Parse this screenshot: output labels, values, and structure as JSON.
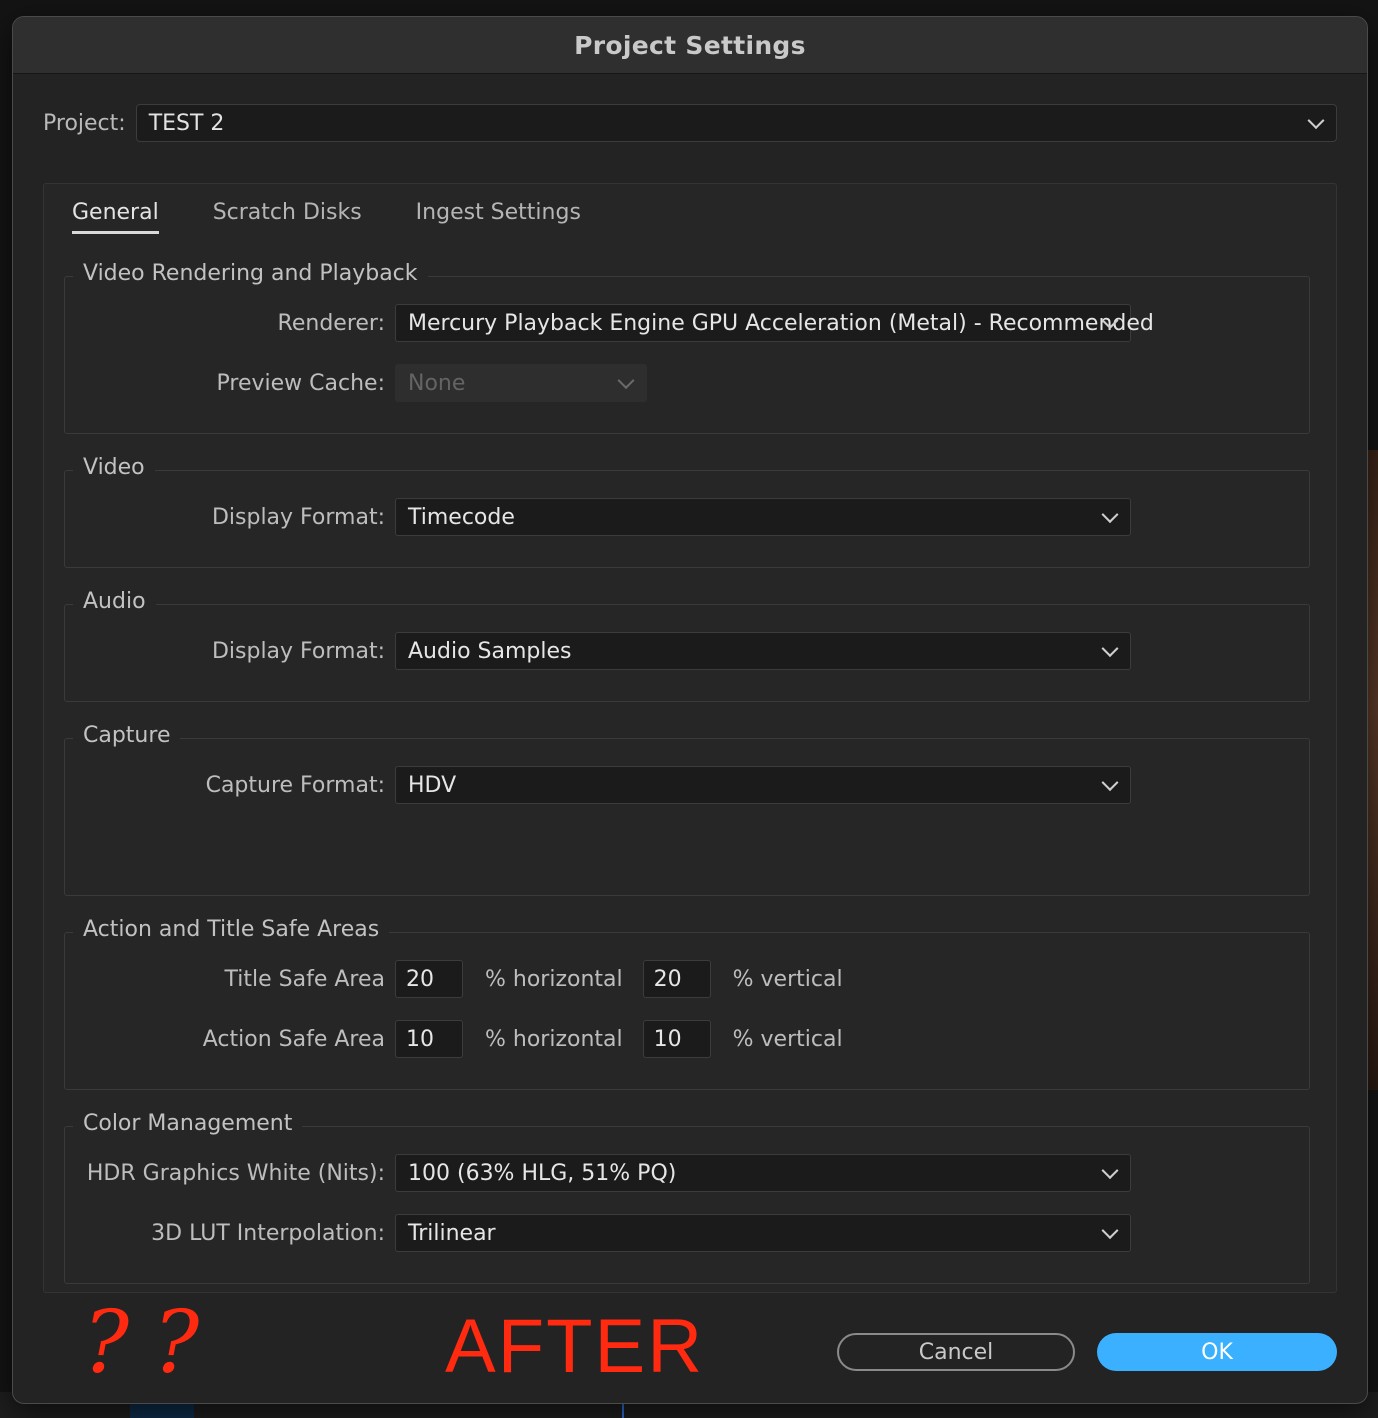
{
  "window": {
    "title": "Project Settings"
  },
  "project": {
    "label": "Project:",
    "value": "TEST 2"
  },
  "tabs": [
    {
      "label": "General",
      "active": true
    },
    {
      "label": "Scratch Disks",
      "active": false
    },
    {
      "label": "Ingest Settings",
      "active": false
    }
  ],
  "sections": {
    "video_rendering": {
      "title": "Video Rendering and Playback",
      "renderer_label": "Renderer:",
      "renderer_value": "Mercury Playback Engine GPU Acceleration (Metal) - Recommended",
      "preview_cache_label": "Preview Cache:",
      "preview_cache_value": "None"
    },
    "video": {
      "title": "Video",
      "display_format_label": "Display Format:",
      "display_format_value": "Timecode"
    },
    "audio": {
      "title": "Audio",
      "display_format_label": "Display Format:",
      "display_format_value": "Audio Samples"
    },
    "capture": {
      "title": "Capture",
      "capture_format_label": "Capture Format:",
      "capture_format_value": "HDV"
    },
    "safe_areas": {
      "title": "Action and Title Safe Areas",
      "title_safe_label": "Title Safe Area",
      "title_safe_horizontal": "20",
      "title_safe_vertical": "20",
      "action_safe_label": "Action Safe Area",
      "action_safe_horizontal": "10",
      "action_safe_vertical": "10",
      "horizontal_unit": "% horizontal",
      "vertical_unit": "% vertical"
    },
    "color_management": {
      "title": "Color Management",
      "hdr_white_label": "HDR Graphics White (Nits):",
      "hdr_white_value": "100 (63% HLG, 51% PQ)",
      "lut_label": "3D LUT Interpolation:",
      "lut_value": "Trilinear"
    }
  },
  "annotations": {
    "question_marks": "??",
    "after_text": "AFTER"
  },
  "buttons": {
    "cancel": "Cancel",
    "ok": "OK"
  },
  "colors": {
    "ok_button": "#3ab0ff",
    "annotation_red": "#ff2a0f",
    "dialog_bg": "#232323"
  },
  "icons": {
    "dropdown": "chevron-down-icon"
  }
}
